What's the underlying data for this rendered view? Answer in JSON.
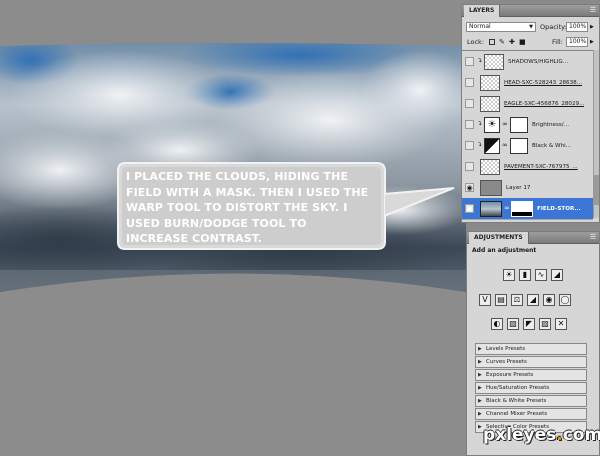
{
  "callout": {
    "lines": [
      "I PLACED THE CLOUDS, HIDING THE",
      "FIELD WITH A MASK. THEN I USED THE",
      "WARP TOOL TO DISTORT THE SKY. I",
      "USED BURN/DODGE TOOL TO",
      "INCREASE CONTRAST."
    ]
  },
  "layers_panel": {
    "tab": "LAYERS",
    "blend_mode": "Normal",
    "opacity_label": "Opacity:",
    "opacity_value": "100%",
    "lock_label": "Lock:",
    "fill_label": "Fill:",
    "fill_value": "100%",
    "layers": [
      {
        "name": "SHADOWS/HIGHLIG...",
        "underline": false
      },
      {
        "name": "HEAD-SXC-528243_28638...",
        "underline": true
      },
      {
        "name": "EAGLE-SXC-456876_28029...",
        "underline": true
      },
      {
        "name": "Brightness/...",
        "underline": false
      },
      {
        "name": "Black & Whi...",
        "underline": false
      },
      {
        "name": "PAVEMENT-SXC-767975_...",
        "underline": true
      },
      {
        "name": "Layer 17",
        "underline": false
      },
      {
        "name": "FIELD-STOR...",
        "underline": false
      }
    ]
  },
  "adjustments_panel": {
    "tab": "ADJUSTMENTS",
    "subtitle": "Add an adjustment",
    "presets": [
      "Levels Presets",
      "Curves Presets",
      "Exposure Presets",
      "Hue/Saturation Presets",
      "Black & White Presets",
      "Channel Mixer Presets",
      "Selective Color Presets"
    ]
  },
  "watermark": {
    "pre": "pxleyes",
    "dot": ".",
    "post": "com"
  }
}
